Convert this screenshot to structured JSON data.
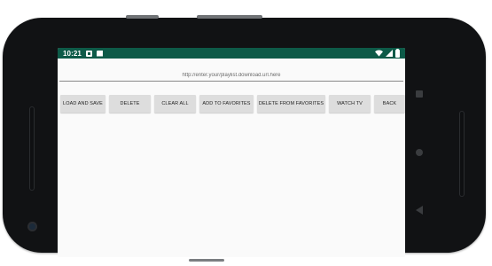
{
  "status_bar": {
    "time": "10:21",
    "background_color": "#0d5a48",
    "left_icons": [
      "notification-square-icon",
      "sd-card-icon"
    ],
    "right_icons": [
      "wifi-icon",
      "signal-icon",
      "battery-icon"
    ]
  },
  "url_input": {
    "placeholder": "http://enter.your/playlist.download.url.here",
    "value": ""
  },
  "buttons": {
    "load_and_save": "LOAD AND SAVE",
    "delete": "DELETE",
    "clear_all": "CLEAR ALL",
    "add_to_favorites": "ADD TO FAVORITES",
    "delete_from_favorites": "DELETE FROM FAVORITES",
    "watch_tv": "WATCH TV",
    "back": "BACK"
  },
  "navigation": {
    "recent_icon": "recent-apps-icon",
    "home_icon": "home-icon",
    "back_icon": "back-triangle-icon"
  }
}
